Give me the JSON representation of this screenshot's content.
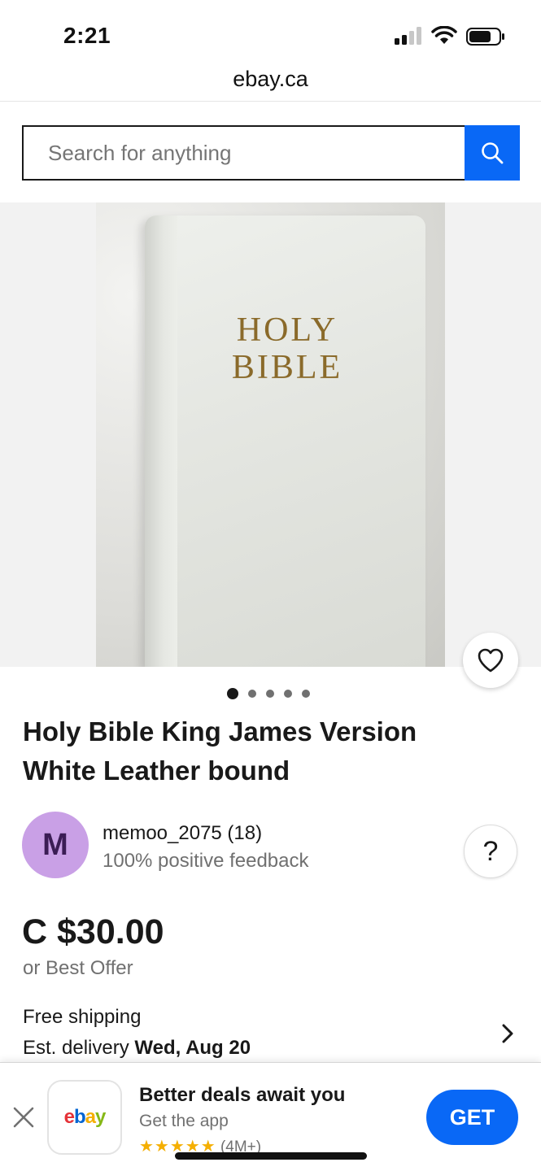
{
  "status_bar": {
    "time": "2:21"
  },
  "browser": {
    "url": "ebay.ca"
  },
  "search": {
    "placeholder": "Search for anything"
  },
  "gallery": {
    "image_text": "HOLY BIBLE",
    "image_count": 5,
    "active_index": 0
  },
  "listing": {
    "title": "Holy Bible King James Version White Leather bound",
    "seller": {
      "initial": "M",
      "name": "memoo_2075 (18)",
      "feedback": "100% positive feedback",
      "avatar_color": "#c9a0e6"
    },
    "price": "C $30.00",
    "offer": "or Best Offer",
    "shipping": "Free shipping",
    "delivery_label": "Est. delivery",
    "delivery_date": "Wed, Aug 20"
  },
  "app_banner": {
    "title": "Better deals await you",
    "subtitle": "Get the app",
    "stars": "★★★★★",
    "rating_count": "(4M+)",
    "get_label": "GET",
    "logo": {
      "e": "e",
      "b": "b",
      "a": "a",
      "y": "y"
    }
  },
  "colors": {
    "accent": "#0968f6",
    "text": "#191919",
    "muted": "#707070"
  },
  "icons": [
    "signal-icon",
    "wifi-icon",
    "battery-icon",
    "search-icon",
    "heart-icon",
    "help-icon",
    "chevron-right-icon",
    "close-icon"
  ]
}
